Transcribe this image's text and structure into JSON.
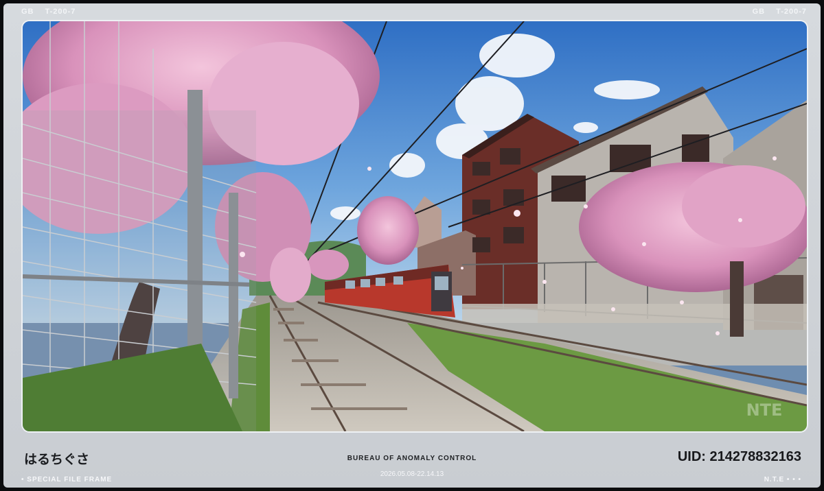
{
  "corners": {
    "top_left": [
      "GB",
      "T-200-7"
    ],
    "top_right": [
      "GB",
      "T-200-7"
    ]
  },
  "photo": {
    "watermark": "NTE"
  },
  "footer": {
    "name": "はるちぐさ",
    "title": "BUREAU OF ANOMALY CONTROL",
    "timestamp": "2026.05.08-22.14.13",
    "uid": "UID: 214278832163",
    "left_label": "• SPECIAL FILE FRAME",
    "right_label": "N.T.E • • •"
  },
  "colors": {
    "frame": "#d0d4d8",
    "sky": "#3f78c8",
    "blossom": "#e6a8c8",
    "train": "#b8382c"
  }
}
